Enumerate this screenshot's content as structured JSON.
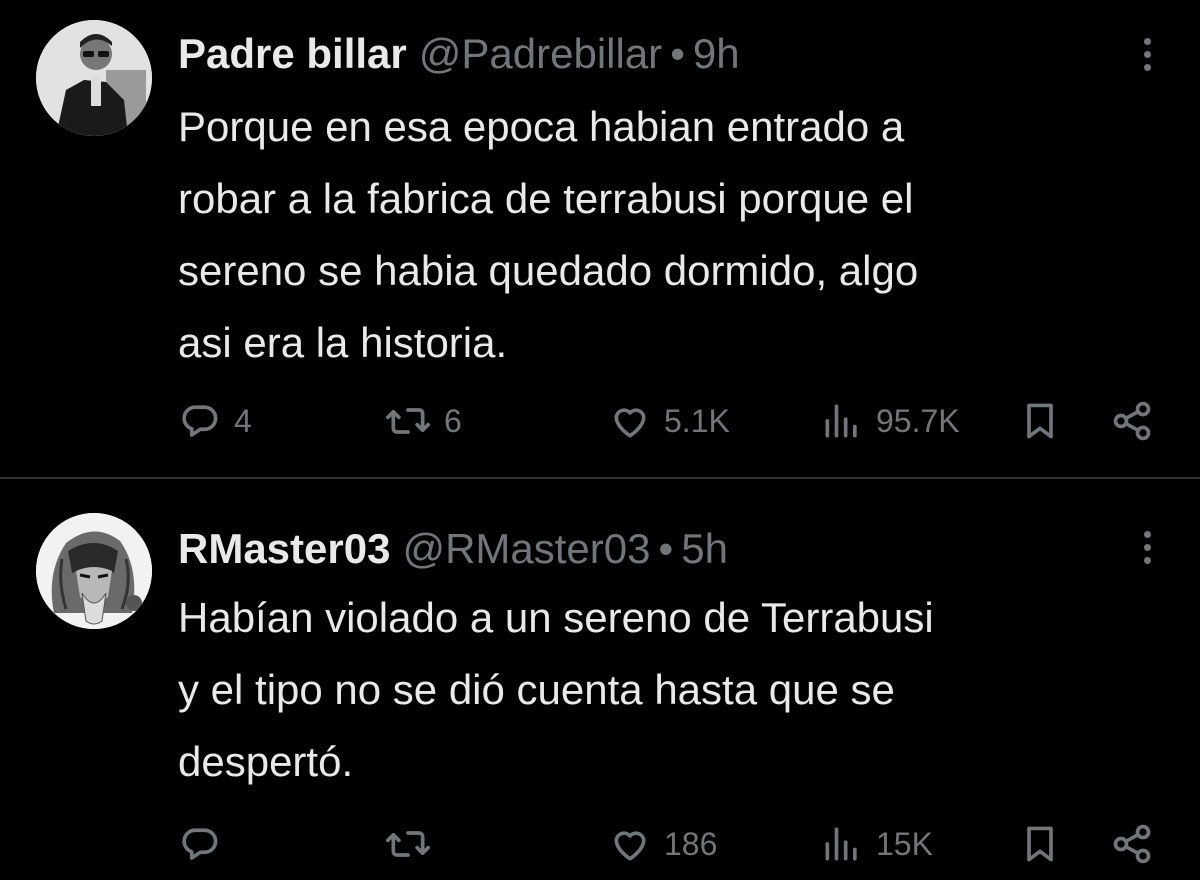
{
  "tweets": [
    {
      "display_name": "Padre billar",
      "handle": "@Padrebillar",
      "separator": "•",
      "time": "9h",
      "text": "Porque en esa epoca habian entrado a\nrobar a la fabrica de terrabusi porque el\nsereno se habia quedado dormido, algo\nasi era la historia.",
      "replies": "4",
      "retweets": "6",
      "likes": "5.1K",
      "views": "95.7K"
    },
    {
      "display_name": "RMaster03",
      "handle": "@RMaster03",
      "separator": "•",
      "time": "5h",
      "text": "Habían violado a un sereno de Terrabusi\ny el tipo no se dió cuenta hasta que se\ndespertó.",
      "replies": "",
      "retweets": "",
      "likes": "186",
      "views": "15K"
    }
  ],
  "colors": {
    "background": "#000000",
    "text_primary": "#e7e9ea",
    "text_secondary": "#71767b",
    "divider": "#2f3336"
  },
  "icons": [
    "reply-icon",
    "retweet-icon",
    "like-icon",
    "views-icon",
    "bookmark-icon",
    "share-icon",
    "more-icon"
  ]
}
